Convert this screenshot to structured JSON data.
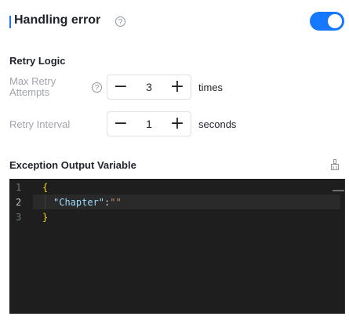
{
  "header": {
    "title": "Handling error",
    "help_glyph": "?",
    "toggle_on": true
  },
  "retry": {
    "section_title": "Retry Logic",
    "max_attempts": {
      "label_line1": "Max Retry",
      "label_line2": "Attempts",
      "value": "3",
      "unit": "times",
      "minus": "−",
      "plus": "+"
    },
    "interval": {
      "label": "Retry Interval",
      "value": "1",
      "unit": "seconds",
      "minus": "−",
      "plus": "+"
    }
  },
  "exception": {
    "section_title": "Exception Output Variable",
    "clear_icon": "broom-icon"
  },
  "editor": {
    "line_numbers": [
      "1",
      "2",
      "3"
    ],
    "lines": {
      "l1_brace": "{",
      "l2_key": "\"Chapter\"",
      "l2_colon": ":",
      "l2_value": "\"\"",
      "l3_brace": "}"
    }
  },
  "colors": {
    "accent": "#1677ff",
    "editor_bg": "#1e1e1e"
  }
}
